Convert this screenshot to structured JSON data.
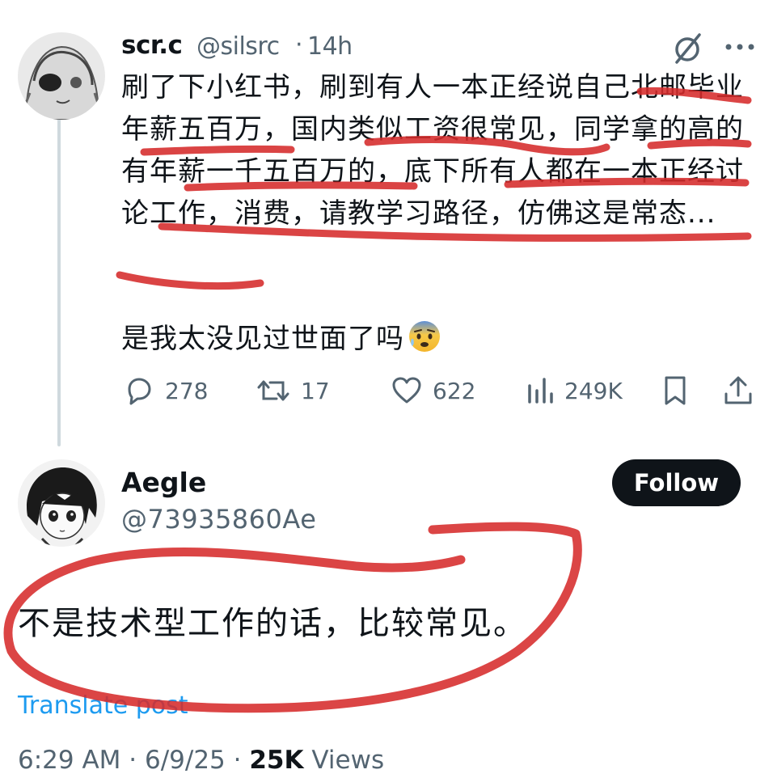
{
  "post": {
    "author_name": "scr.c",
    "author_handle": "@silsrc",
    "separator": "·",
    "time": "14h",
    "text": "刷了下小红书，刷到有人一本正经说自己北邮毕业年薪五百万，国内类似工资很常见，同学拿的高的有年薪一千五百万的，底下所有人都在一本正经讨论工作，消费，请教学习路径，仿佛这是常态...",
    "question": "是我太没见过世面了吗",
    "emoji": "anxious-face-with-sweat",
    "stats": {
      "replies": "278",
      "reposts": "17",
      "likes": "622",
      "views": "249K"
    }
  },
  "reply": {
    "author_name": "Aegle",
    "author_handle": "@73935860Ae",
    "follow_label": "Follow",
    "text": "不是技术型工作的话，比较常见。",
    "translate_label": "Translate post",
    "time": "6:29 AM",
    "date": "6/9/25",
    "separator": "·",
    "views_count": "25K",
    "views_label": "Views"
  },
  "colors": {
    "text": "#0f1419",
    "secondary": "#536471",
    "link": "#1d9bf0",
    "annotation": "#d62b2b",
    "thread_line": "#cfd9de"
  }
}
